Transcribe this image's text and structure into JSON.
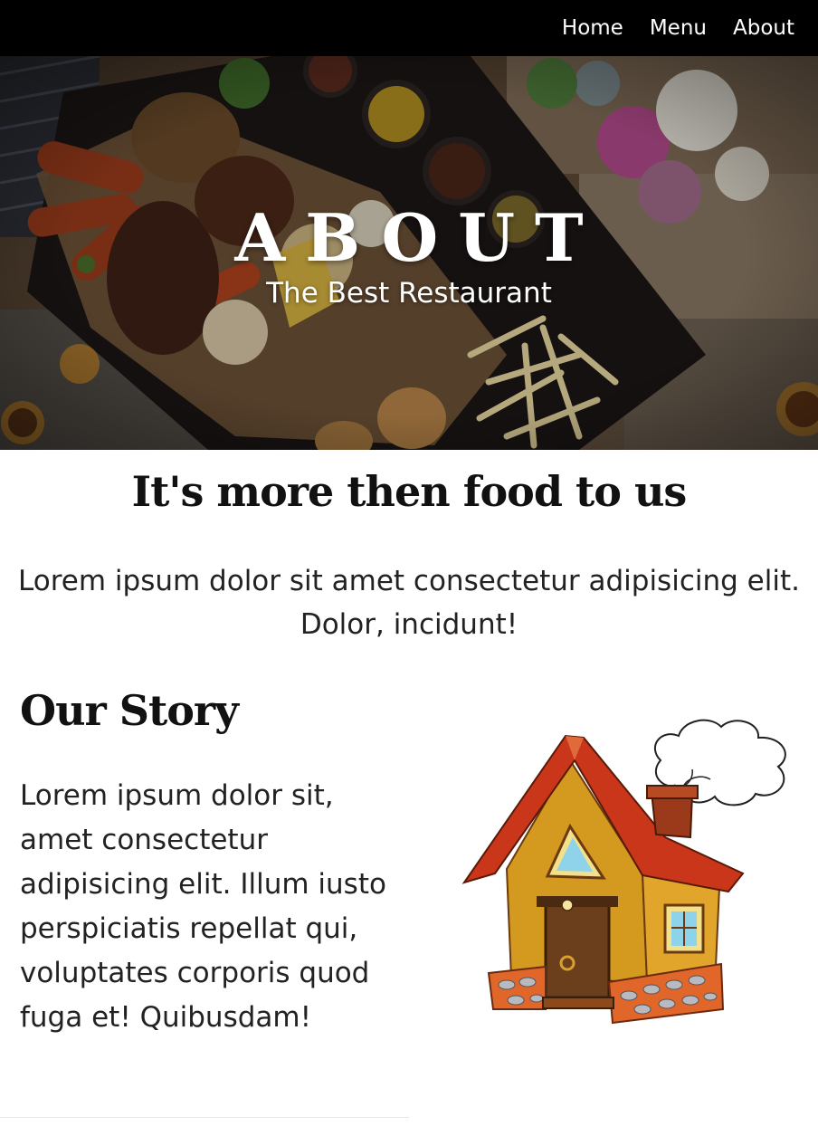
{
  "nav": {
    "items": [
      {
        "label": "Home"
      },
      {
        "label": "Menu"
      },
      {
        "label": "About"
      }
    ]
  },
  "hero": {
    "title": "ABOUT",
    "subtitle": "The Best Restaurant"
  },
  "intro": {
    "heading": "It's more then food to us",
    "text": "Lorem ipsum dolor sit amet consectetur adipisicing elit. Dolor, incidunt!"
  },
  "story": {
    "heading": "Our Story",
    "text": "Lorem ipsum dolor sit, amet consectetur adipisicing elit. Illum iusto perspiciatis repellat qui, voluptates corporis quod fuga et! Quibusdam!"
  }
}
